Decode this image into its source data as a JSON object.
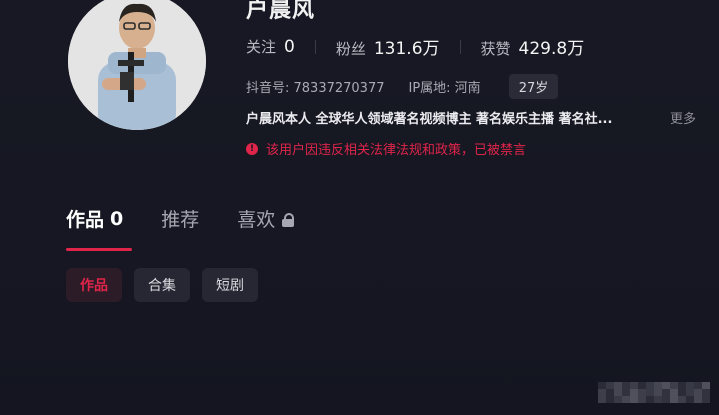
{
  "profile": {
    "name": "户晨风",
    "stats": [
      {
        "label": "关注",
        "value": "0"
      },
      {
        "label": "粉丝",
        "value": "131.6万"
      },
      {
        "label": "获赞",
        "value": "429.8万"
      }
    ],
    "douyin_id": "抖音号: 78337270377",
    "ip_location": "IP属地: 河南",
    "age": "27岁",
    "bio": "户晨风本人 全球华人领域著名视频博主 著名娱乐主播 著名社...",
    "more_label": "更多",
    "ban_notice": "该用户因违反相关法律法规和政策，已被禁言"
  },
  "tabs": [
    {
      "label": "作品",
      "count": "0",
      "active": true
    },
    {
      "label": "推荐",
      "active": false
    },
    {
      "label": "喜欢",
      "locked": true,
      "active": false
    }
  ],
  "filter_chips": [
    {
      "label": "作品",
      "active": true
    },
    {
      "label": "合集",
      "active": false
    },
    {
      "label": "短剧",
      "active": false
    }
  ],
  "colors": {
    "accent": "#e0244a",
    "background": "#171823",
    "chip_bg": "#262733"
  }
}
